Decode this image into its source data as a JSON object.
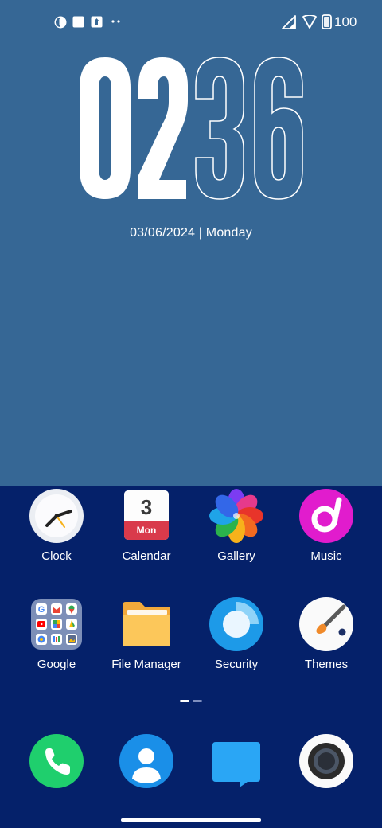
{
  "status_bar": {
    "battery": "100",
    "icons": [
      "app-notification-icon",
      "square-notification-icon",
      "upload-icon",
      "more-notifications-icon",
      "signal-icon",
      "wifi-icon",
      "battery-icon"
    ]
  },
  "lock_clock": {
    "hours": "02",
    "minutes": "36",
    "date": "03/06/2024 | Monday"
  },
  "apps": [
    {
      "label": "Clock",
      "icon": "clock-icon"
    },
    {
      "label": "Calendar",
      "icon": "calendar-icon",
      "day": "3",
      "weekday": "Mon"
    },
    {
      "label": "Gallery",
      "icon": "gallery-icon"
    },
    {
      "label": "Music",
      "icon": "music-icon"
    },
    {
      "label": "Google",
      "icon": "google-folder-icon"
    },
    {
      "label": "File Manager",
      "icon": "folder-icon"
    },
    {
      "label": "Security",
      "icon": "security-icon"
    },
    {
      "label": "Themes",
      "icon": "themes-icon"
    }
  ],
  "dock": [
    {
      "name": "phone",
      "icon": "phone-icon"
    },
    {
      "name": "contacts",
      "icon": "contacts-icon"
    },
    {
      "name": "messages",
      "icon": "messages-icon"
    },
    {
      "name": "camera",
      "icon": "camera-icon"
    }
  ],
  "pager": {
    "pages": 2,
    "current": 1
  },
  "colors": {
    "wallpaper": "#366795",
    "dock_background": "#05216a",
    "phone": "#1fcf6d",
    "contacts": "#1a8fe8",
    "messages": "#2aa6f5",
    "music": "#e11ccd"
  }
}
